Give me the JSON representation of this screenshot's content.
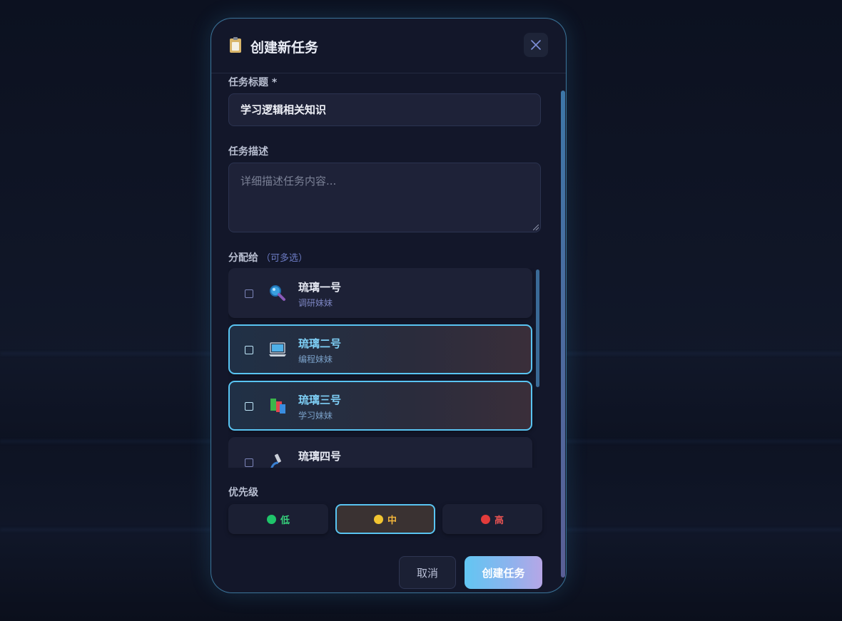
{
  "modal": {
    "title": "创建新任务",
    "title_icon": "clipboard-icon",
    "close_icon": "close-icon"
  },
  "form": {
    "title_label": "任务标题 *",
    "title_value": "学习逻辑相关知识",
    "description_label": "任务描述",
    "description_placeholder": "详细描述任务内容...",
    "assign_label": "分配给",
    "assign_hint": "（可多选）",
    "priority_label": "优先级"
  },
  "members": [
    {
      "name": "琉璃一号",
      "role": "调研妹妹",
      "icon": "magnifier-icon",
      "selected": false
    },
    {
      "name": "琉璃二号",
      "role": "编程妹妹",
      "icon": "laptop-icon",
      "selected": true
    },
    {
      "name": "琉璃三号",
      "role": "学习妹妹",
      "icon": "books-icon",
      "selected": true
    },
    {
      "name": "琉璃四号",
      "role": "",
      "icon": "microscope-icon",
      "selected": false
    }
  ],
  "priorities": [
    {
      "label": "低",
      "color": "#1fc46a",
      "text_color": "#36d27c",
      "selected": false
    },
    {
      "label": "中",
      "color": "#f2c531",
      "text_color": "#f2b53a",
      "selected": true
    },
    {
      "label": "高",
      "color": "#e23b3b",
      "text_color": "#e45252",
      "selected": false
    }
  ],
  "actions": {
    "cancel": "取消",
    "submit": "创建任务"
  }
}
